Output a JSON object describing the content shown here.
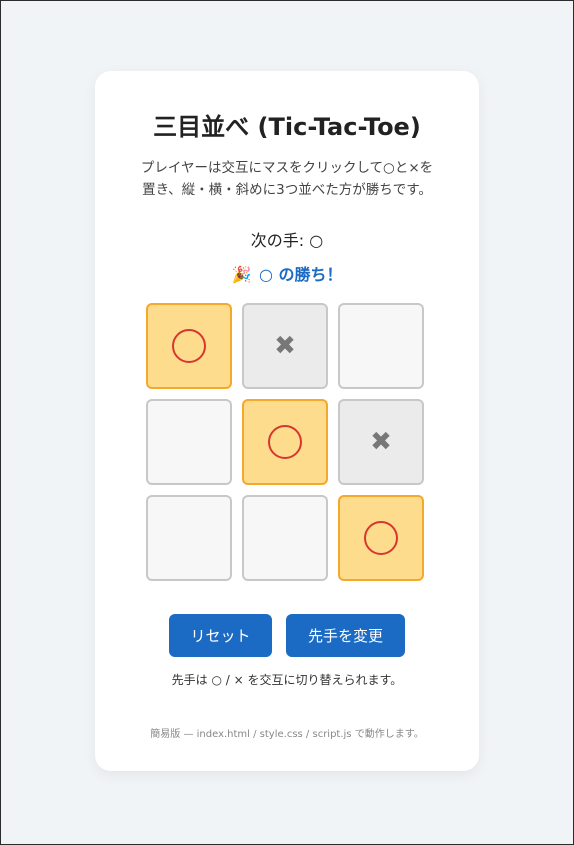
{
  "game": {
    "title": "三目並べ (Tic-Tac-Toe)",
    "description_line1": "プレイヤーは交互にマスをクリックして○と×を",
    "description_line2": "置き、縦・横・斜めに3つ並べた方が勝ちです。",
    "turn_label": "次の手: ○",
    "status_emoji": "🎉",
    "status_text": "○ の勝ち！"
  },
  "board": {
    "cells": [
      "O",
      "X",
      "",
      "",
      "O",
      "X",
      "",
      "",
      "O"
    ],
    "winning_cells": [
      0,
      4,
      8
    ]
  },
  "controls": {
    "reset_label": "リセット",
    "swap_label": "先手を変更",
    "hint": "先手は ○ / × を交互に切り替えられます。"
  },
  "footer": {
    "text": "簡易版 — index.html / style.css / script.js で動作します。"
  },
  "colors": {
    "accent": "#1b6ac3",
    "win_bg": "#fddc8d",
    "win_border": "#f4a92c",
    "o_mark": "#d7372f",
    "x_mark": "#777777"
  }
}
